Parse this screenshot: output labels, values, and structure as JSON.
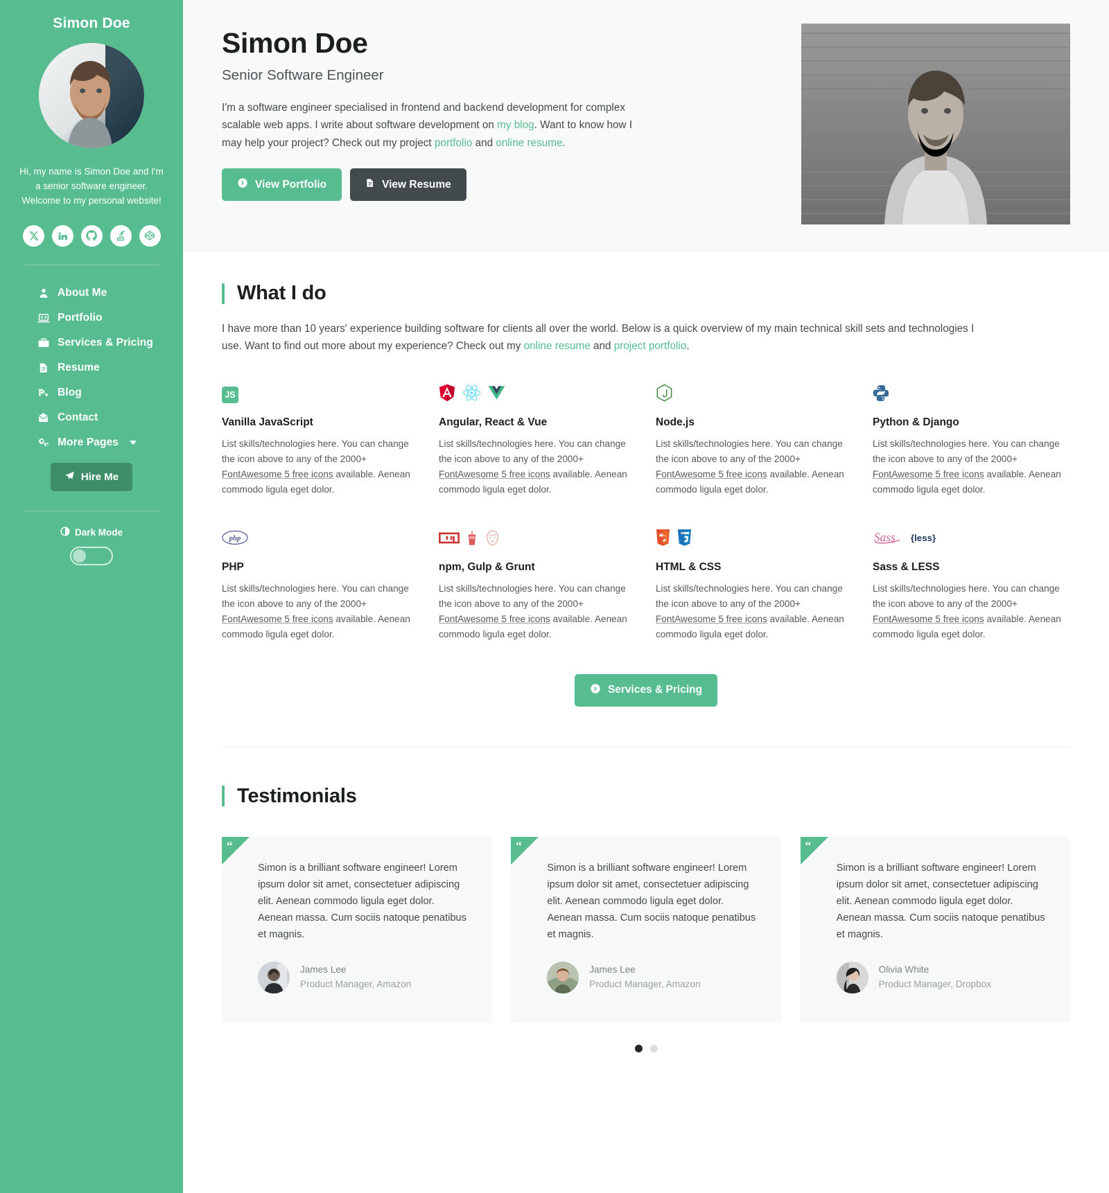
{
  "sidebar": {
    "brand_name": "Simon Doe",
    "avatar_alt": "portrait-photo",
    "tagline": "Hi, my name is Simon Doe and I'm a senior software engineer. Welcome to my personal website!",
    "social": [
      {
        "name": "twitter-x-icon",
        "label": "X"
      },
      {
        "name": "linkedin-icon",
        "label": "in"
      },
      {
        "name": "github-icon",
        "label": "GitHub"
      },
      {
        "name": "stack-overflow-icon",
        "label": "Stack Overflow"
      },
      {
        "name": "codepen-icon",
        "label": "CodePen"
      }
    ],
    "nav": [
      {
        "label": "About Me",
        "icon": "user-icon"
      },
      {
        "label": "Portfolio",
        "icon": "laptop-code-icon"
      },
      {
        "label": "Services & Pricing",
        "icon": "briefcase-icon"
      },
      {
        "label": "Resume",
        "icon": "file-text-icon"
      },
      {
        "label": "Blog",
        "icon": "blogger-icon"
      },
      {
        "label": "Contact",
        "icon": "envelope-open-icon"
      },
      {
        "label": "More Pages",
        "icon": "cogs-icon",
        "has_caret": true
      }
    ],
    "hire_label": "Hire Me",
    "dark_mode_label": "Dark Mode",
    "dark_mode_on": false
  },
  "hero": {
    "title": "Simon Doe",
    "subtitle": "Senior Software Engineer",
    "para_1": "I'm a software engineer specialised in frontend and backend development for complex scalable web apps. I write about software development on ",
    "link_blog": "my blog",
    "para_2": ". Want to know how I may help your project? Check out my project ",
    "link_portfolio": "portfolio",
    "para_3": " and ",
    "link_resume": "online resume",
    "para_4": ".",
    "btn_portfolio": "View Portfolio",
    "btn_resume": "View Resume"
  },
  "what_i_do": {
    "title": "What I do",
    "para_1": "I have more than 10 years' experience building software for clients all over the world. Below is a quick overview of my main technical skill sets and technologies I use. Want to find out more about my experience? Check out my ",
    "link_resume": "online resume",
    "para_2": " and ",
    "link_portfolio": "project portfolio",
    "para_3": ".",
    "desc_a": "List skills/technologies here. You can change the icon above to any of the 2000+ ",
    "desc_link": "FontAwesome 5 free icons",
    "desc_b": " available. Aenean commodo ligula eget dolor.",
    "skills": [
      {
        "name": "Vanilla JavaScript",
        "icons": [
          "js-badge-icon"
        ]
      },
      {
        "name": "Angular, React & Vue",
        "icons": [
          "angular-icon",
          "react-icon",
          "vue-icon"
        ]
      },
      {
        "name": "Node.js",
        "icons": [
          "nodejs-icon"
        ]
      },
      {
        "name": "Python & Django",
        "icons": [
          "python-icon"
        ]
      },
      {
        "name": "PHP",
        "icons": [
          "php-icon"
        ]
      },
      {
        "name": "npm, Gulp & Grunt",
        "icons": [
          "npm-icon",
          "gulp-icon",
          "grunt-icon"
        ]
      },
      {
        "name": "HTML & CSS",
        "icons": [
          "html5-icon",
          "css3-icon"
        ]
      },
      {
        "name": "Sass & LESS",
        "icons": [
          "sass-icon",
          "less-icon"
        ]
      }
    ],
    "cta_label": "Services & Pricing"
  },
  "testimonials": {
    "title": "Testimonials",
    "items": [
      {
        "quote": "Simon is a brilliant software engineer! Lorem ipsum dolor sit amet, consectetuer adipiscing elit. Aenean commodo ligula eget dolor. Aenean massa. Cum sociis natoque penatibus et magnis.",
        "name": "James Lee",
        "role": "Product Manager, Amazon"
      },
      {
        "quote": "Simon is a brilliant software engineer! Lorem ipsum dolor sit amet, consectetuer adipiscing elit. Aenean commodo ligula eget dolor. Aenean massa. Cum sociis natoque penatibus et magnis.",
        "name": "James Lee",
        "role": "Product Manager, Amazon"
      },
      {
        "quote": "Simon is a brilliant software engineer! Lorem ipsum dolor sit amet, consectetuer adipiscing elit. Aenean commodo ligula eget dolor. Aenean massa. Cum sociis natoque penatibus et magnis.",
        "name": "Olivia White",
        "role": "Product Manager, Dropbox"
      }
    ],
    "dots": [
      {
        "active": true
      },
      {
        "active": false
      }
    ]
  },
  "colors": {
    "accent": "#57bc90",
    "accent_dark": "#3e8e68",
    "dark_btn": "#434a4d",
    "text": "#1c1f20",
    "muted": "#55595b"
  }
}
